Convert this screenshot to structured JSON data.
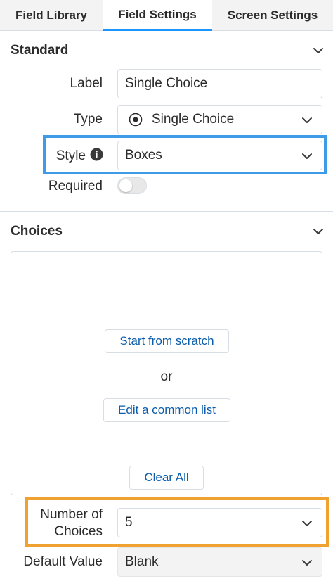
{
  "tabs": [
    "Field Library",
    "Field Settings",
    "Screen Settings"
  ],
  "standard": {
    "title": "Standard",
    "label_label": "Label",
    "label_value": "Single Choice",
    "type_label": "Type",
    "type_value": "Single Choice",
    "style_label": "Style",
    "style_value": "Boxes",
    "required_label": "Required",
    "required_on": false
  },
  "choices": {
    "title": "Choices",
    "start_button": "Start from scratch",
    "or_text": "or",
    "common_list_button": "Edit a common list",
    "clear_all_button": "Clear All",
    "number_label_line1": "Number of",
    "number_label_line2": "Choices",
    "number_value": "5",
    "default_label": "Default Value",
    "default_value": "Blank"
  },
  "colors": {
    "accent_tab": "#1b96ff",
    "highlight_blue": "#3e9be8",
    "highlight_orange": "#f0a230",
    "link_blue": "#0b5cab"
  },
  "icons": [
    "chevron-down-icon",
    "radio-selected-icon",
    "info-icon"
  ]
}
